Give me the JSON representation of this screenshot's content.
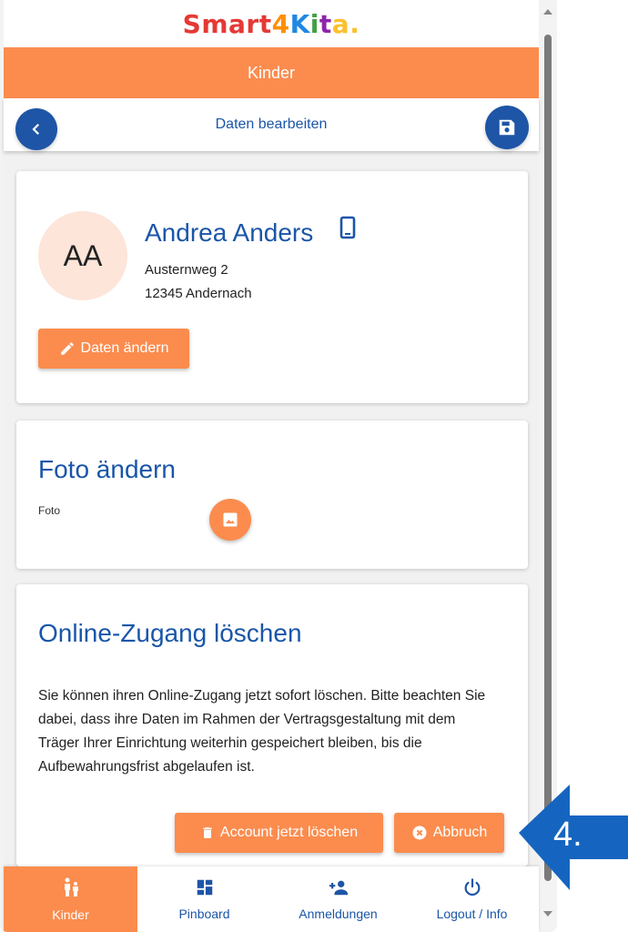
{
  "logo": {
    "letters": [
      "S",
      "m",
      "a",
      "r",
      "t",
      "4",
      "K",
      "i",
      "t",
      "a",
      "."
    ],
    "colors": [
      "#e53935",
      "#e53935",
      "#e53935",
      "#e53935",
      "#e53935",
      "#ff8f00",
      "#1e88e5",
      "#43a047",
      "#8e24aa",
      "#fbc02d",
      "#fbc02d"
    ]
  },
  "header": {
    "title": "Kinder"
  },
  "subheader": {
    "title": "Daten bearbeiten",
    "back_icon": "chevron-left-icon",
    "save_icon": "save-icon"
  },
  "profile": {
    "initials": "AA",
    "name": "Andrea Anders",
    "street": "Austernweg 2",
    "city": "12345 Andernach",
    "edit_label": "Daten ändern"
  },
  "photo": {
    "title": "Foto ändern",
    "label": "Foto"
  },
  "delete_section": {
    "title": "Online-Zugang löschen",
    "text": "Sie können ihren Online-Zugang jetzt sofort löschen. Bitte beachten Sie dabei, dass ihre Daten im Rahmen der Vertragsgestaltung mit dem Träger Ihrer Einrichtung weiterhin gespeichert bleiben, bis die Aufbewahrungsfrist abgelaufen ist.",
    "delete_label": "Account jetzt löschen",
    "cancel_label": "Abbruch"
  },
  "bottom_nav": [
    {
      "label": "Kinder",
      "icon": "child-icon"
    },
    {
      "label": "Pinboard",
      "icon": "dashboard-icon"
    },
    {
      "label": "Anmeldungen",
      "icon": "add-person-icon"
    },
    {
      "label": "Logout / Info",
      "icon": "power-icon"
    }
  ],
  "annotation": {
    "step": "4."
  },
  "colors": {
    "accent": "#fb8c4e",
    "primary": "#1e55a6",
    "arrow": "#1565c0"
  }
}
